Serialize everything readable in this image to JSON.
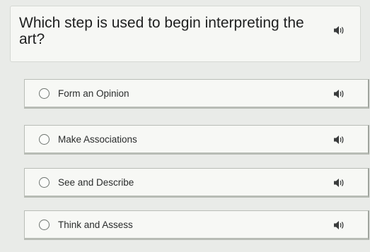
{
  "question": {
    "text": "Which step is used to begin interpreting the art?",
    "speaker_icon": "speaker-icon"
  },
  "options": [
    {
      "label": "Form an Opinion"
    },
    {
      "label": "Make Associations"
    },
    {
      "label": "See and Describe"
    },
    {
      "label": "Think and Assess"
    }
  ],
  "colors": {
    "background": "#e9ebe8",
    "card": "#f7f8f5",
    "border": "#b9bdb7",
    "text": "#1e1f1f"
  }
}
